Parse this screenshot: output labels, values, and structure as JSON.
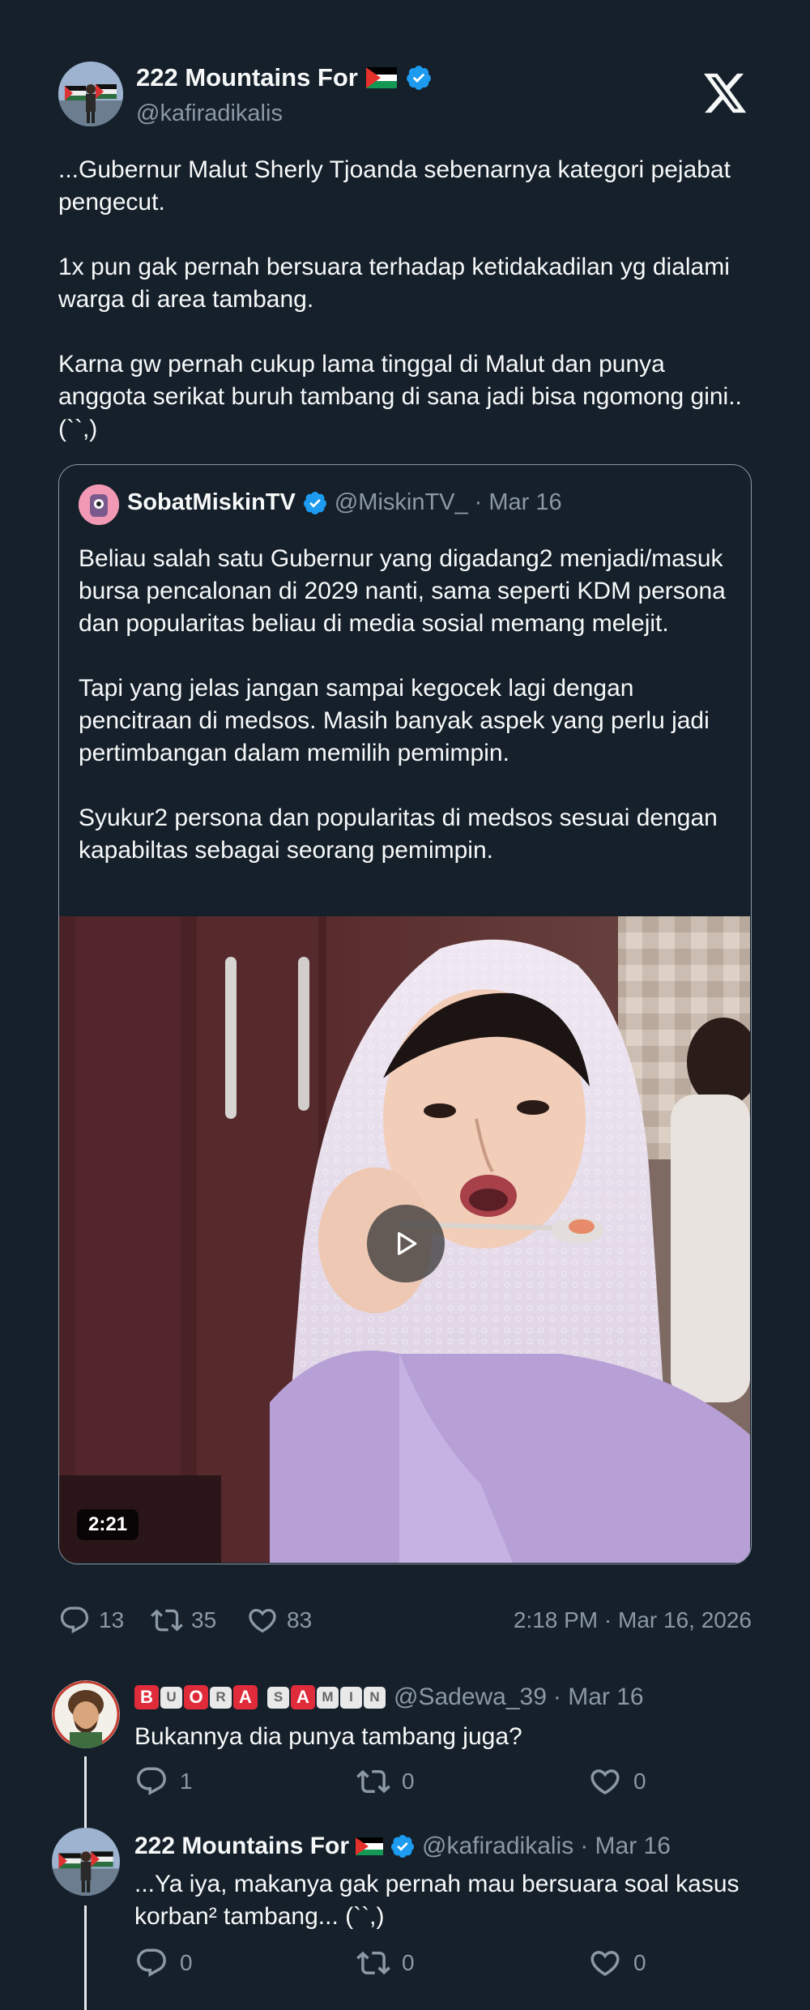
{
  "tweet": {
    "author_name": "222 Mountains For",
    "author_handle": "@kafiradikalis",
    "paragraphs": [
      "...Gubernur Malut Sherly Tjoanda sebenarnya kategori pejabat pengecut.",
      "1x pun gak pernah bersuara terhadap ketidakadilan yg dialami warga di area tambang.",
      "Karna gw pernah cukup lama tinggal di Malut dan punya anggota serikat buruh tambang di sana jadi bisa ngomong gini.. (``,)"
    ],
    "stats": {
      "replies": "13",
      "reposts": "35",
      "likes": "83"
    },
    "timestamp": "2:18 PM · Mar 16, 2026"
  },
  "quote": {
    "author_name": "SobatMiskinTV",
    "author_handle": "@MiskinTV_",
    "date": "· Mar 16",
    "paragraphs": [
      "Beliau salah satu Gubernur yang digadang2 menjadi/masuk bursa pencalonan di 2029 nanti, sama seperti KDM persona dan popularitas beliau di media sosial memang melejit.",
      "Tapi yang jelas jangan sampai kegocek lagi dengan pencitraan di medsos. Masih banyak aspek yang perlu jadi pertimbangan dalam memilih pemimpin.",
      "Syukur2 persona dan popularitas di medsos sesuai dengan kapabiltas sebagai seorang pemimpin."
    ],
    "video_duration": "2:21"
  },
  "replies": [
    {
      "author_name_letters": [
        "B",
        "U",
        "O",
        "R",
        "A",
        "S",
        "A",
        "M",
        "I",
        "N"
      ],
      "author_name_styles": [
        "red",
        "white",
        "red",
        "white",
        "red",
        "white",
        "red",
        "white",
        "white",
        "white"
      ],
      "author_handle": "@Sadewa_39",
      "date": "· Mar 16",
      "text": "Bukannya dia punya tambang juga?",
      "stats": {
        "replies": "1",
        "reposts": "0",
        "likes": "0"
      }
    },
    {
      "author_name": "222 Mountains For",
      "author_handle": "@kafiradikalis",
      "date": "· Mar 16",
      "text": "...Ya iya, makanya gak pernah mau bersuara soal kasus korban² tambang... (``,)",
      "stats": {
        "replies": "0",
        "reposts": "0",
        "likes": "0"
      }
    }
  ],
  "icons": {
    "reply": "speech-bubble-icon",
    "repost": "repost-arrows-icon",
    "like": "heart-icon",
    "verified": "verified-badge-icon",
    "logo": "x-logo-icon",
    "flag": "palestine-flag-icon"
  },
  "colors": {
    "background": "#15202b",
    "text_primary": "#f7f9f9",
    "text_secondary": "#8b98a5",
    "verified_blue": "#1d9bf0"
  }
}
